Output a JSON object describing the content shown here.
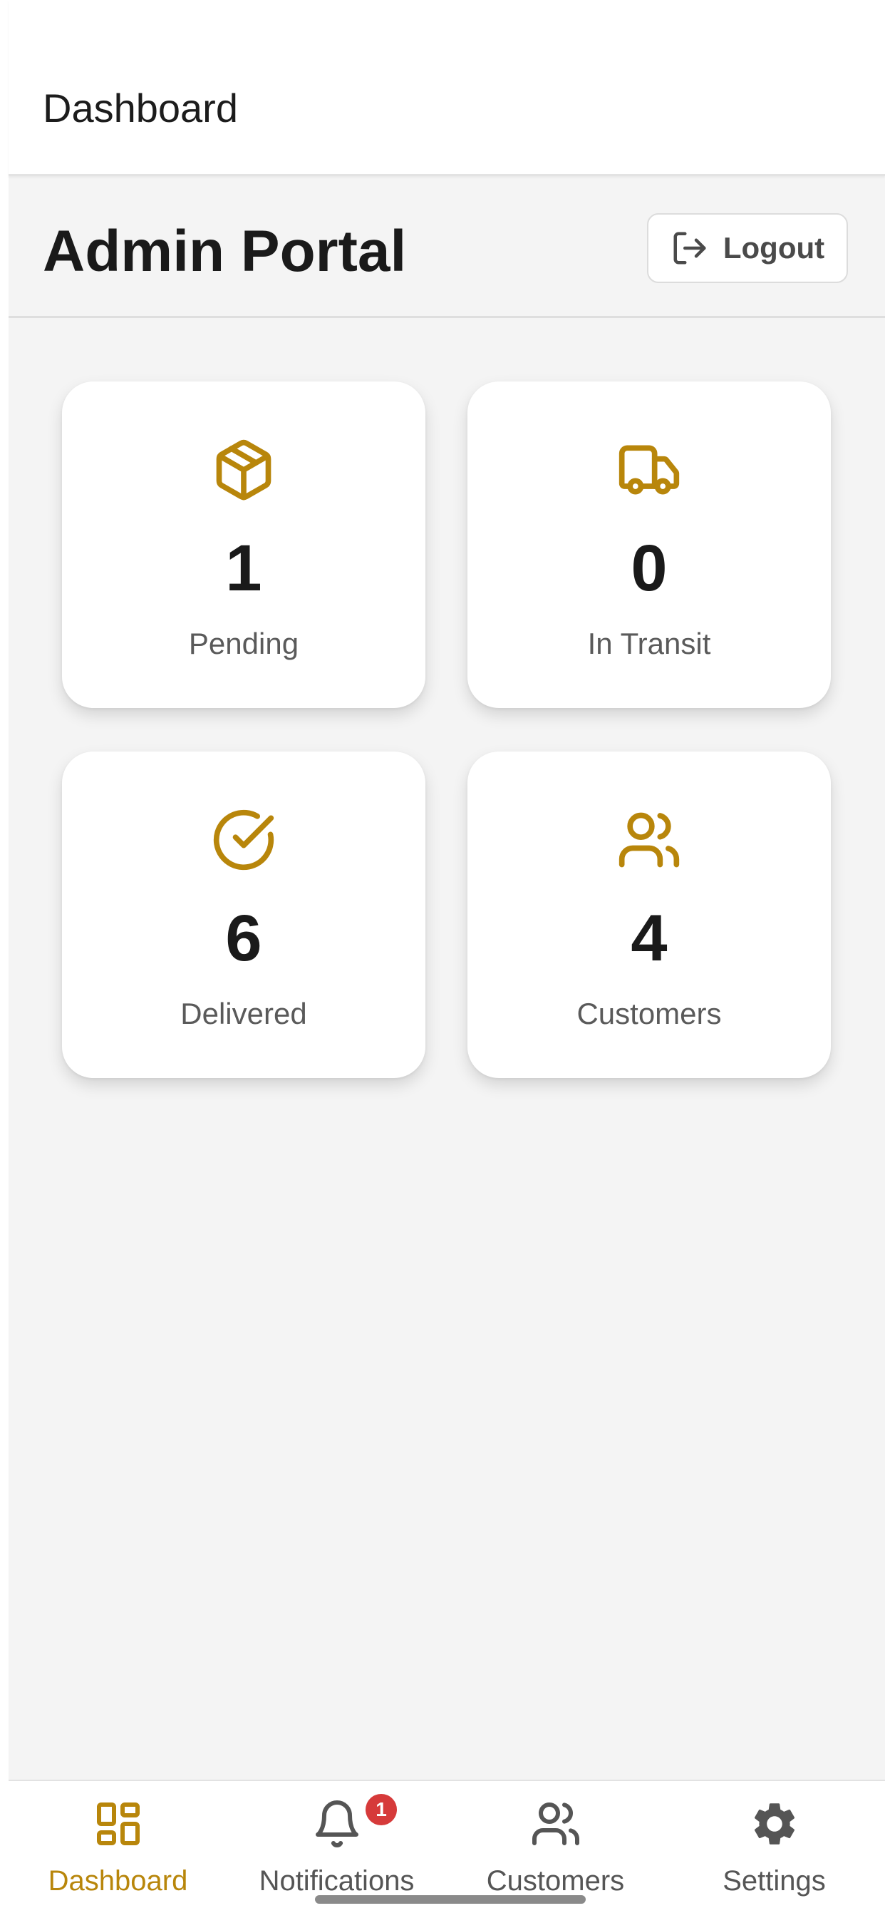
{
  "header": {
    "title": "Dashboard"
  },
  "portal": {
    "title": "Admin Portal",
    "logout_label": "Logout"
  },
  "colors": {
    "accent": "#b8860b",
    "badge": "#d63a3a",
    "background": "#f4f4f4"
  },
  "stats": [
    {
      "icon": "package-icon",
      "value": "1",
      "label": "Pending"
    },
    {
      "icon": "truck-icon",
      "value": "0",
      "label": "In Transit"
    },
    {
      "icon": "check-circle-icon",
      "value": "6",
      "label": "Delivered"
    },
    {
      "icon": "users-icon",
      "value": "4",
      "label": "Customers"
    }
  ],
  "tabbar": {
    "tabs": [
      {
        "label": "Dashboard",
        "icon": "grid-icon",
        "active": true
      },
      {
        "label": "Notifications",
        "icon": "bell-icon",
        "badge": "1"
      },
      {
        "label": "Customers",
        "icon": "users-icon"
      },
      {
        "label": "Settings",
        "icon": "gear-icon"
      }
    ]
  }
}
